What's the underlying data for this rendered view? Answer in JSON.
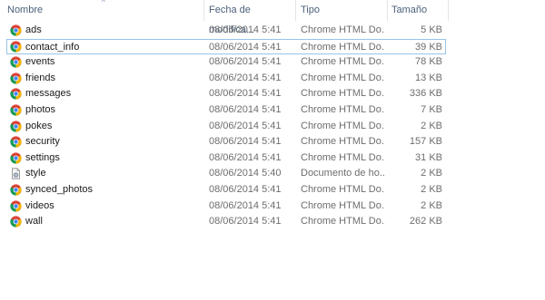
{
  "columns": {
    "name": "Nombre",
    "date": "Fecha de modifica...",
    "type": "Tipo",
    "size": "Tamaño"
  },
  "files": [
    {
      "name": "ads",
      "date": "08/06/2014 5:41",
      "type": "Chrome HTML Do...",
      "size": "5 KB",
      "icon": "chrome-icon",
      "selected": false
    },
    {
      "name": "contact_info",
      "date": "08/06/2014 5:41",
      "type": "Chrome HTML Do...",
      "size": "39 KB",
      "icon": "chrome-icon",
      "selected": true
    },
    {
      "name": "events",
      "date": "08/06/2014 5:41",
      "type": "Chrome HTML Do...",
      "size": "78 KB",
      "icon": "chrome-icon",
      "selected": false
    },
    {
      "name": "friends",
      "date": "08/06/2014 5:41",
      "type": "Chrome HTML Do...",
      "size": "13 KB",
      "icon": "chrome-icon",
      "selected": false
    },
    {
      "name": "messages",
      "date": "08/06/2014 5:41",
      "type": "Chrome HTML Do...",
      "size": "336 KB",
      "icon": "chrome-icon",
      "selected": false
    },
    {
      "name": "photos",
      "date": "08/06/2014 5:41",
      "type": "Chrome HTML Do...",
      "size": "7 KB",
      "icon": "chrome-icon",
      "selected": false
    },
    {
      "name": "pokes",
      "date": "08/06/2014 5:41",
      "type": "Chrome HTML Do...",
      "size": "2 KB",
      "icon": "chrome-icon",
      "selected": false
    },
    {
      "name": "security",
      "date": "08/06/2014 5:41",
      "type": "Chrome HTML Do...",
      "size": "157 KB",
      "icon": "chrome-icon",
      "selected": false
    },
    {
      "name": "settings",
      "date": "08/06/2014 5:41",
      "type": "Chrome HTML Do...",
      "size": "31 KB",
      "icon": "chrome-icon",
      "selected": false
    },
    {
      "name": "style",
      "date": "08/06/2014 5:40",
      "type": "Documento de ho...",
      "size": "2 KB",
      "icon": "stylesheet-file-icon",
      "selected": false
    },
    {
      "name": "synced_photos",
      "date": "08/06/2014 5:41",
      "type": "Chrome HTML Do...",
      "size": "2 KB",
      "icon": "chrome-icon",
      "selected": false
    },
    {
      "name": "videos",
      "date": "08/06/2014 5:41",
      "type": "Chrome HTML Do...",
      "size": "2 KB",
      "icon": "chrome-icon",
      "selected": false
    },
    {
      "name": "wall",
      "date": "08/06/2014 5:41",
      "type": "Chrome HTML Do...",
      "size": "262 KB",
      "icon": "chrome-icon",
      "selected": false
    }
  ],
  "colors": {
    "header_text": "#4c607a",
    "selection_border": "#99c4e8",
    "secondary_text": "#6d6d6d"
  }
}
